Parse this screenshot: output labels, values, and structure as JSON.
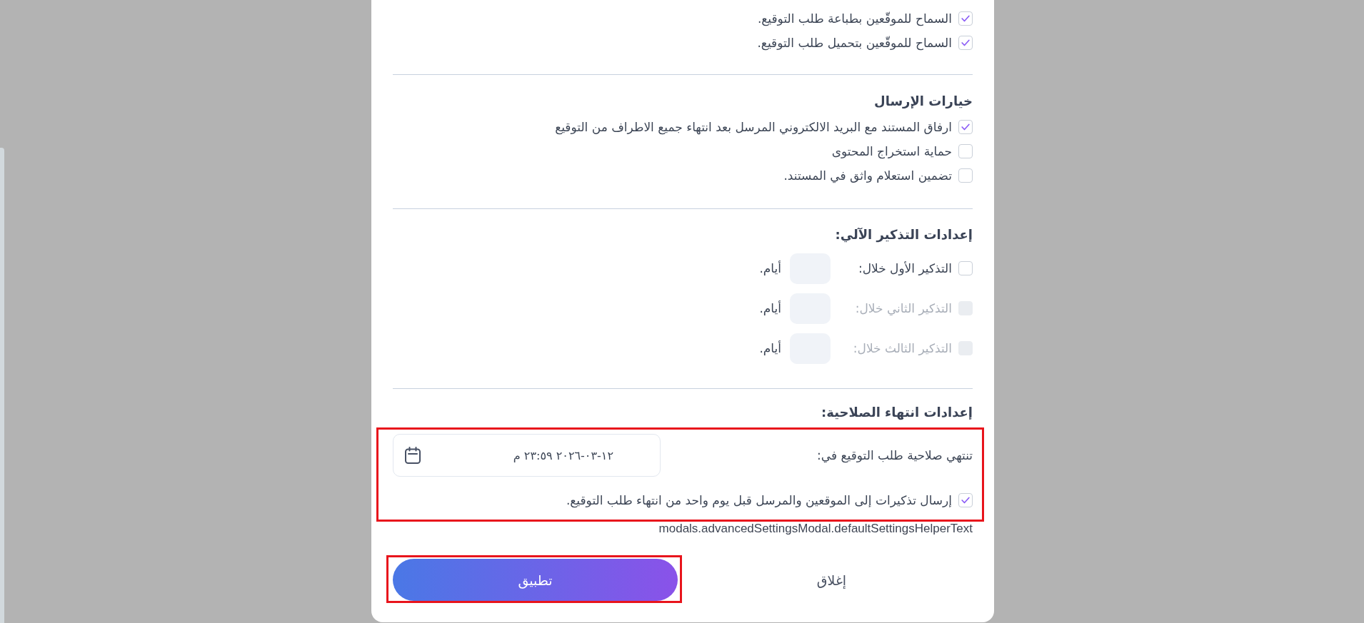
{
  "permissions": [
    {
      "label": "السماح للموقّعين بطباعة طلب التوقيع.",
      "checked": true
    },
    {
      "label": "السماح للموقّعين بتحميل طلب التوقيع.",
      "checked": true
    }
  ],
  "sending_options": {
    "title": "خيارات الإرسال",
    "items": [
      {
        "label": "ارفاق المستند مع البريد الالكتروني المرسل بعد انتهاء جميع الاطراف من التوقيع",
        "checked": true
      },
      {
        "label": "حماية استخراج المحتوى",
        "checked": false
      },
      {
        "label": "تضمين استعلام واثق في المستند.",
        "checked": false
      }
    ]
  },
  "auto_reminders": {
    "title": "إعدادات التذكير الآلي:",
    "items": [
      {
        "label": "التذكير الأول خلال:",
        "checked": false,
        "disabled": false,
        "unit": "أيام."
      },
      {
        "label": "التذكير الثاني خلال:",
        "checked": false,
        "disabled": true,
        "unit": "أيام."
      },
      {
        "label": "التذكير الثالث خلال:",
        "checked": false,
        "disabled": true,
        "unit": "أيام."
      }
    ]
  },
  "expiry": {
    "title": "إعدادات انتهاء الصلاحية:",
    "highlighted": true,
    "date_label": "تنتهي صلاحية طلب التوقيع في:",
    "date_value": "١٢-٠٣-٢٠٢٦ ٢٣:٥٩ م",
    "reminder": {
      "label": "إرسال تذكيرات إلى الموقعين والمرسل قبل يوم واحد من انتهاء طلب التوقيع.",
      "checked": true
    }
  },
  "helper_text": "modals.advancedSettingsModal.defaultSettingsHelperText",
  "buttons": [
    {
      "label": "إغلاق",
      "kind": "secondary",
      "highlighted": false
    },
    {
      "label": "تطبيق",
      "kind": "primary",
      "highlighted": true
    }
  ]
}
